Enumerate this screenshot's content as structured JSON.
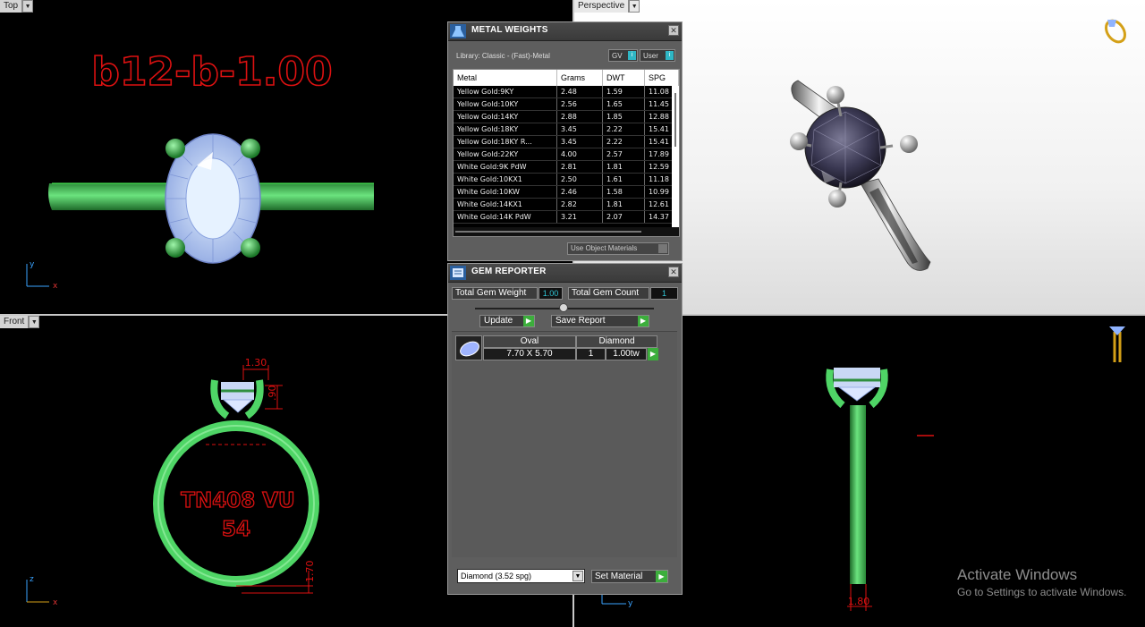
{
  "viewports": {
    "top": {
      "label": "Top",
      "text": "b12-b-1.00",
      "axis_y": "y",
      "axis_x": "x"
    },
    "perspective": {
      "label": "Perspective"
    },
    "front": {
      "label": "Front",
      "text_line1": "TN408 VU",
      "text_line2": "54",
      "axis_y": "z",
      "axis_x": "x",
      "dim1": "1.30",
      "dim2": ".90",
      "dim3": "1.70"
    },
    "right": {
      "axis_y": "y",
      "dim1": "1.80"
    }
  },
  "metal_weights": {
    "title": "METAL WEIGHTS",
    "library": "Library: Classic - (Fast)-Metal",
    "toggle_gv": "GV",
    "toggle_user": "User",
    "columns": [
      "Metal",
      "Grams",
      "DWT",
      "SPG"
    ],
    "rows": [
      [
        "Yellow Gold:9KY",
        "2.48",
        "1.59",
        "11.08"
      ],
      [
        "Yellow Gold:10KY",
        "2.56",
        "1.65",
        "11.45"
      ],
      [
        "Yellow Gold:14KY",
        "2.88",
        "1.85",
        "12.88"
      ],
      [
        "Yellow Gold:18KY",
        "3.45",
        "2.22",
        "15.41"
      ],
      [
        "Yellow Gold:18KY R...",
        "3.45",
        "2.22",
        "15.41"
      ],
      [
        "Yellow Gold:22KY",
        "4.00",
        "2.57",
        "17.89"
      ],
      [
        "White Gold:9K PdW",
        "2.81",
        "1.81",
        "12.59"
      ],
      [
        "White Gold:10KX1",
        "2.50",
        "1.61",
        "11.18"
      ],
      [
        "White Gold:10KW",
        "2.46",
        "1.58",
        "10.99"
      ],
      [
        "White Gold:14KX1",
        "2.82",
        "1.81",
        "12.61"
      ],
      [
        "White Gold:14K PdW",
        "3.21",
        "2.07",
        "14.37"
      ]
    ],
    "use_object_materials": "Use Object Materials"
  },
  "gem_reporter": {
    "title": "GEM REPORTER",
    "total_weight_label": "Total Gem Weight",
    "total_weight_value": "1.00",
    "total_count_label": "Total Gem Count",
    "total_count_value": "1",
    "update_label": "Update",
    "save_report_label": "Save Report",
    "gem": {
      "shape": "Oval",
      "type": "Diamond",
      "size": "7.70 X 5.70",
      "count": "1",
      "weight": "1.00tw"
    },
    "material_select": "Diamond     (3.52 spg)",
    "set_material_label": "Set Material"
  },
  "watermark": {
    "line1": "Activate Windows",
    "line2": "Go to Settings to activate Windows."
  }
}
